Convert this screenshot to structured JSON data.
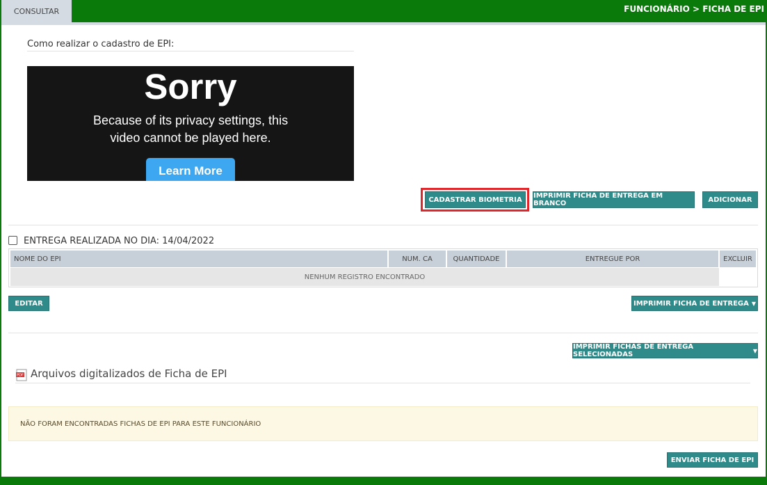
{
  "header": {
    "tab_label": "CONSULTAR",
    "breadcrumb": "FUNCIONÁRIO > FICHA DE EPI"
  },
  "video_section": {
    "title": "Como realizar o cadastro de EPI:",
    "sorry": "Sorry",
    "message_line1": "Because of its privacy settings, this",
    "message_line2": "video cannot be played here.",
    "learn_more": "Learn More"
  },
  "actions": {
    "cadastrar_biometria": "CADASTRAR BIOMETRIA",
    "imprimir_branco": "IMPRIMIR FICHA DE ENTREGA EM BRANCO",
    "adicionar": "ADICIONAR"
  },
  "entrega": {
    "label": "ENTREGA REALIZADA NO DIA: 14/04/2022",
    "checked": false,
    "columns": [
      "NOME DO EPI",
      "NUM. CA",
      "QUANTIDADE",
      "ENTREGUE POR",
      "EXCLUIR"
    ],
    "empty_message": "NENHUM REGISTRO ENCONTRADO",
    "editar": "EDITAR",
    "imprimir_ficha": "IMPRIMIR FICHA DE ENTREGA"
  },
  "selecionadas": {
    "imprimir_selecionadas": "IMPRIMIR FICHAS DE ENTREGA SELECIONADAS"
  },
  "arquivos": {
    "title": "Arquivos digitalizados de Ficha de EPI",
    "icon": "pdf-icon",
    "alert": "NÃO FORAM ENCONTRADAS FICHAS DE EPI PARA ESTE FUNCIONÁRIO",
    "enviar": "ENVIAR FICHA DE EPI"
  },
  "colors": {
    "brand_green": "#0a7a0a",
    "button_teal": "#2f8a8a",
    "highlight_red": "#e0252b",
    "alert_bg": "#fcf8e3"
  }
}
